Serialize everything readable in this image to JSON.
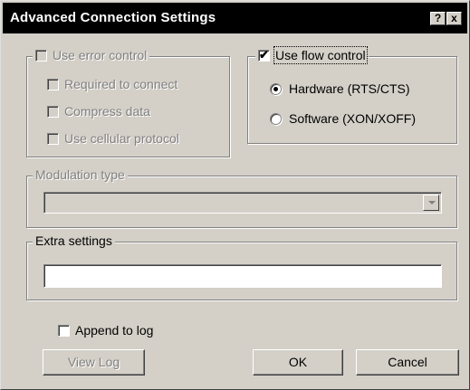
{
  "window": {
    "title": "Advanced Connection Settings",
    "help_glyph": "?",
    "close_glyph": "x"
  },
  "error_control": {
    "label": "Use error control",
    "checked": false,
    "enabled": false,
    "options": [
      {
        "label": "Required to connect",
        "checked": false
      },
      {
        "label": "Compress data",
        "checked": false
      },
      {
        "label": "Use cellular protocol",
        "checked": false
      }
    ]
  },
  "flow_control": {
    "label": "Use flow control",
    "checked": true,
    "options": [
      {
        "label": "Hardware (RTS/CTS)",
        "selected": true
      },
      {
        "label": "Software (XON/XOFF)",
        "selected": false
      }
    ]
  },
  "modulation": {
    "label": "Modulation type",
    "value": "",
    "enabled": false
  },
  "extra_settings": {
    "label": "Extra settings",
    "value": ""
  },
  "append_log": {
    "label": "Append to log",
    "checked": false
  },
  "buttons": {
    "view_log": "View Log",
    "ok": "OK",
    "cancel": "Cancel"
  }
}
